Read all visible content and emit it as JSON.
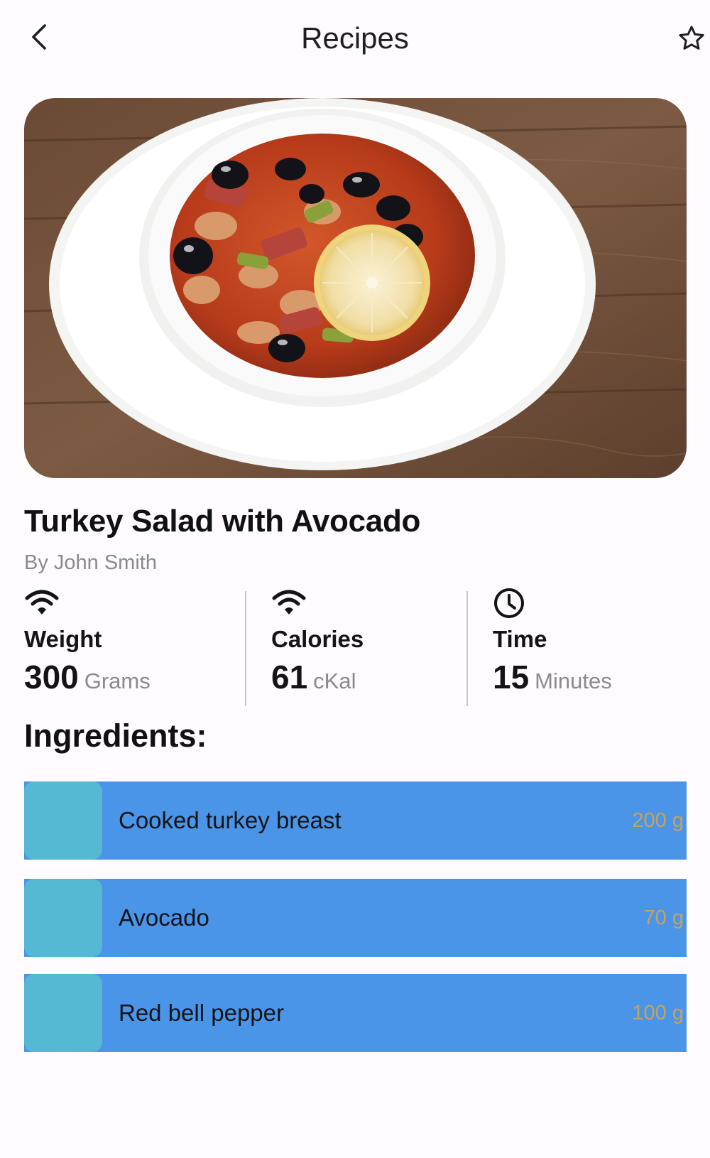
{
  "app_bar": {
    "title": "Recipes",
    "back_icon": "chevron-left-icon",
    "favorite_icon": "star-outline-icon"
  },
  "hero_image": {
    "subject": "bowl of soup with olives, sausage and lemon slice on wooden table"
  },
  "recipe": {
    "title": "Turkey Salad with Avocado",
    "author": "By John Smith"
  },
  "stats": [
    {
      "icon": "wifi-icon",
      "label": "Weight",
      "value": "300",
      "unit": "Grams"
    },
    {
      "icon": "wifi-icon",
      "label": "Calories",
      "value": "61",
      "unit": "cKal"
    },
    {
      "icon": "clock-icon",
      "label": "Time",
      "value": "15",
      "unit": "Minutes"
    }
  ],
  "ingredients": {
    "heading": "Ingredients:",
    "items": [
      {
        "name": "Cooked turkey breast",
        "qty": "200 g"
      },
      {
        "name": "Avocado",
        "qty": "70 g"
      },
      {
        "name": "Red bell pepper",
        "qty": "100 g"
      }
    ]
  },
  "colors": {
    "background": "#fffbff",
    "ingredient_row": "#4a95e8",
    "ingredient_thumb": "#55b9d3",
    "quantity_text": "#c7a25c",
    "secondary_text": "#8a8a8e"
  }
}
